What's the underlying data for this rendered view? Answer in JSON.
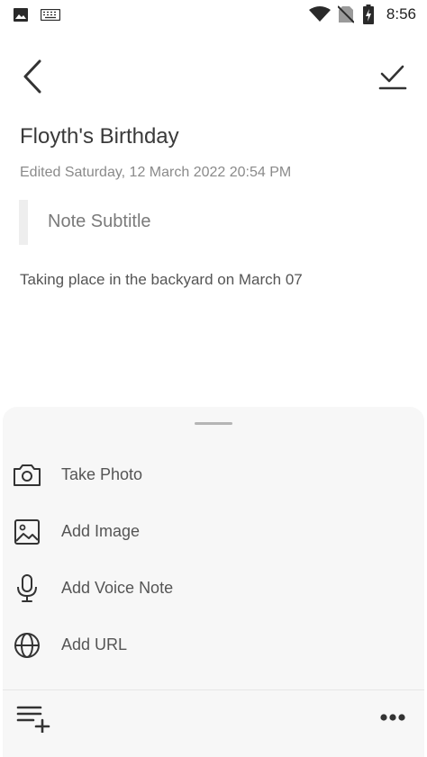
{
  "status_bar": {
    "time": "8:56",
    "icons": [
      "image-icon",
      "keyboard-icon",
      "wifi-icon",
      "no-sim-icon",
      "battery-charging-icon"
    ]
  },
  "toolbar": {
    "back_icon": "back-arrow-icon",
    "save_icon": "checkmark-icon"
  },
  "note": {
    "title": "Floyth's Birthday",
    "edited": "Edited Saturday, 12 March 2022 20:54 PM",
    "subtitle": "Note Subtitle",
    "body": "Taking place in the backyard on March 07"
  },
  "sheet": {
    "items": [
      {
        "label": "Take Photo",
        "icon": "camera-icon"
      },
      {
        "label": "Add Image",
        "icon": "image-icon"
      },
      {
        "label": "Add Voice Note",
        "icon": "microphone-icon"
      },
      {
        "label": "Add URL",
        "icon": "globe-icon"
      }
    ],
    "bottom_left_icon": "add-list-icon",
    "bottom_right_icon": "more-options-icon"
  }
}
